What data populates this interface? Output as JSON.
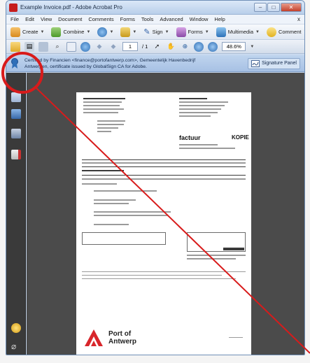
{
  "window": {
    "title": "Example Invoice.pdf - Adobe Acrobat Pro",
    "controls": {
      "minimize": "–",
      "maximize": "□",
      "close": "✕"
    }
  },
  "menu": {
    "items": [
      "File",
      "Edit",
      "View",
      "Document",
      "Comments",
      "Forms",
      "Tools",
      "Advanced",
      "Window",
      "Help"
    ],
    "close_symbol": "x"
  },
  "tasks": {
    "create": "Create",
    "combine": "Combine",
    "sign": "Sign",
    "forms": "Forms",
    "multimedia": "Multimedia",
    "comment": "Comment"
  },
  "tools": {
    "page_current": "1",
    "page_total": "/ 1",
    "zoom": "48.6%"
  },
  "signature": {
    "line1": "Certified by Financien <finance@portofantwerp.com>, Gemeentelijk Havenbedrijf",
    "line2": "Antwerpen, certificate issued by GlobalSign CA for Adobe.",
    "panel_button": "Signature Panel"
  },
  "document": {
    "factuur": "factuur",
    "kopie": "KOPIE",
    "logo_line1": "Port of",
    "logo_line2": "Antwerp"
  },
  "colors": {
    "annotation": "#d81b1b",
    "acrobat_red": "#c61d1d",
    "logo_red": "#d8262b"
  }
}
